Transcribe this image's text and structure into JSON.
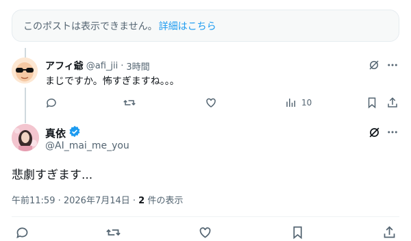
{
  "notice": {
    "text": "このポストは表示できません。",
    "link": "詳細はこちら"
  },
  "reply": {
    "name": "アフィ爺",
    "handle": "@afi_jii",
    "separator": "·",
    "time": "3時間",
    "text": "まじですか。怖すぎますね。。。",
    "views": "10"
  },
  "main_post": {
    "name": "真依",
    "handle": "@AI_mai_me_you",
    "text": "悲劇すぎます...",
    "timestamp": "午前11:59 · 2026年7月14日 · ",
    "view_count": "2",
    "view_suffix": " 件の表示"
  },
  "colors": {
    "accent": "#1d9bf0",
    "muted": "#536471",
    "text": "#0f1419"
  }
}
